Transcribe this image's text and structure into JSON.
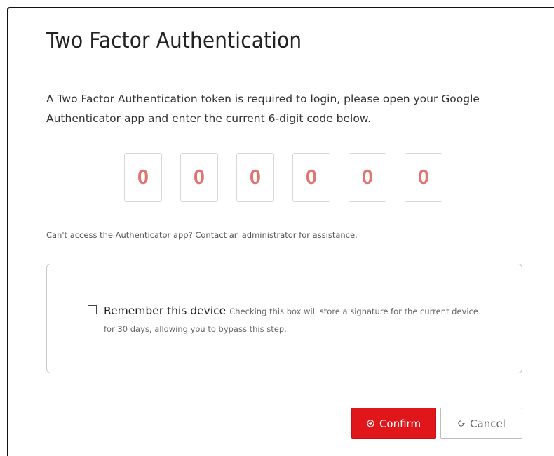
{
  "modal": {
    "title": "Two Factor Authentication",
    "intro": "A Two Factor Authentication token is required to login, please open your Google Authenticator app and enter the current 6-digit code below.",
    "code_digits": [
      "0",
      "0",
      "0",
      "0",
      "0",
      "0"
    ],
    "help_text": "Can't access the Authenticator app? Contact an administrator for assistance.",
    "remember": {
      "checked": false,
      "label": "Remember this device",
      "description": "Checking this box will store a signature for the current device for 30 days, allowing you to bypass this step."
    },
    "buttons": {
      "confirm_label": "Confirm",
      "cancel_label": "Cancel"
    }
  },
  "colors": {
    "accent": "#e0161a",
    "digit_text": "#e07470"
  },
  "icons": {
    "confirm": "arrow-circle-right-icon",
    "cancel": "undo-circle-icon"
  }
}
